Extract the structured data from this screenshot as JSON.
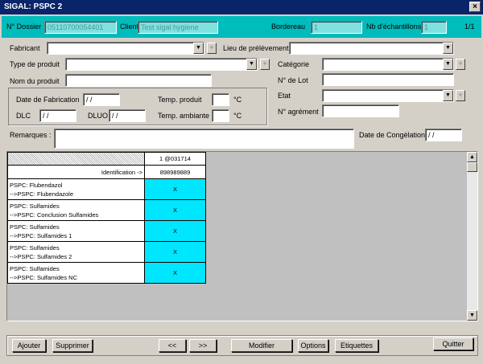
{
  "window": {
    "title": "SIGAL: PSPC 2",
    "close": "×"
  },
  "header": {
    "dossier_label": "N° Dossier",
    "dossier_value": "05110700054401",
    "client_label": "Client",
    "client_value": "Test sigal hygiene",
    "bordereau_label": "Bordereau",
    "bordereau_value": "1",
    "nb_label": "Nb d'échantillons",
    "nb_value": "1",
    "page": "1/1"
  },
  "form": {
    "fabricant": "Fabricant",
    "lieu": "Lieu de prélèvement",
    "type": "Type de produit",
    "categorie": "Catégorie",
    "nom": "Nom du produit",
    "lot": "N° de Lot",
    "date_fab": "Date de Fabrication",
    "date_placeholder": "/ /",
    "temp_produit": "Temp. produit",
    "temp_ambiante": "Temp. ambiante",
    "unit_c": "°C",
    "etat": "Etat",
    "dlc": "DLC",
    "dluo": "DLUO",
    "agrement": "N° agrément",
    "remarques": "Remarques :",
    "date_cong": "Date de Congélation",
    "plus": "+",
    "arrow": "▼"
  },
  "grid": {
    "column": "1 @031714",
    "id_label": "Identification ->",
    "id_value": "898989889",
    "rows": [
      {
        "l1": "PSPC: Flubendazol",
        "l2": "-->PSPC: Flubendazole",
        "v": "X"
      },
      {
        "l1": "PSPC: Sulfamides",
        "l2": "-->PSPC: Conclusion Sulfamides",
        "v": "X"
      },
      {
        "l1": "PSPC: Sulfamides",
        "l2": "-->PSPC: Sulfamides 1",
        "v": "X"
      },
      {
        "l1": "PSPC: Sulfamides",
        "l2": "-->PSPC: Sulfamides 2",
        "v": "X"
      },
      {
        "l1": "PSPC: Sulfamides",
        "l2": "-->PSPC: Sulfamides NC",
        "v": "X"
      }
    ],
    "scroll_up": "▲",
    "scroll_down": "▼"
  },
  "buttons": {
    "ajouter": "Ajouter",
    "supprimer": "Supprimer",
    "prev": "<<",
    "next": ">>",
    "modifier": "Modifier",
    "options": "Options",
    "etiquettes": "Etiquettes",
    "quitter": "Quitter"
  }
}
